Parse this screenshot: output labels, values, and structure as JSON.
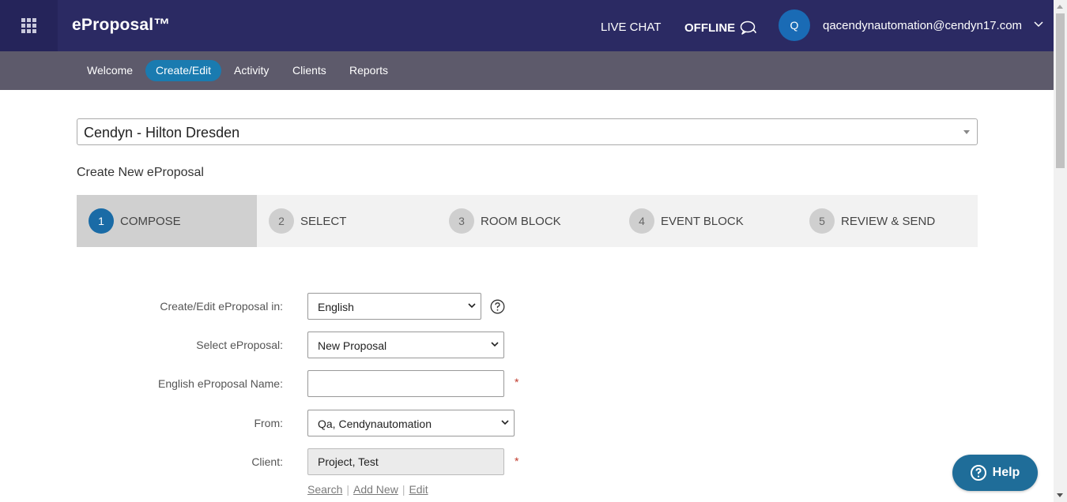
{
  "header": {
    "brand": "eProposal™",
    "live_chat": "LIVE CHAT",
    "offline": "OFFLINE",
    "avatar_initial": "Q",
    "user_email": "qacendynautomation@cendyn17.com"
  },
  "nav": {
    "items": [
      {
        "label": "Welcome"
      },
      {
        "label": "Create/Edit",
        "active": true
      },
      {
        "label": "Activity"
      },
      {
        "label": "Clients"
      },
      {
        "label": "Reports"
      }
    ]
  },
  "property": {
    "selected": "Cendyn - Hilton Dresden"
  },
  "page": {
    "title": "Create New eProposal"
  },
  "steps": [
    {
      "number": "1",
      "label": "COMPOSE",
      "active": true
    },
    {
      "number": "2",
      "label": "SELECT"
    },
    {
      "number": "3",
      "label": "ROOM BLOCK"
    },
    {
      "number": "4",
      "label": "EVENT BLOCK"
    },
    {
      "number": "5",
      "label": "REVIEW & SEND"
    }
  ],
  "form": {
    "language_label": "Create/Edit eProposal in:",
    "language_value": "English",
    "select_label": "Select eProposal:",
    "select_value": "New Proposal",
    "name_label": "English eProposal Name:",
    "name_value": "",
    "from_label": "From:",
    "from_value": "Qa, Cendynautomation",
    "client_label": "Client:",
    "client_value": "Project, Test",
    "required_mark": "*",
    "links": {
      "search": "Search",
      "add_new": "Add New",
      "edit": "Edit",
      "separator": "|"
    }
  },
  "help_widget": {
    "label": "Help"
  },
  "colors": {
    "header_bg": "#2b2a63",
    "nav_bg": "#5d5a6b",
    "accent": "#1a7bb0",
    "help_bg": "#1f6d99"
  }
}
